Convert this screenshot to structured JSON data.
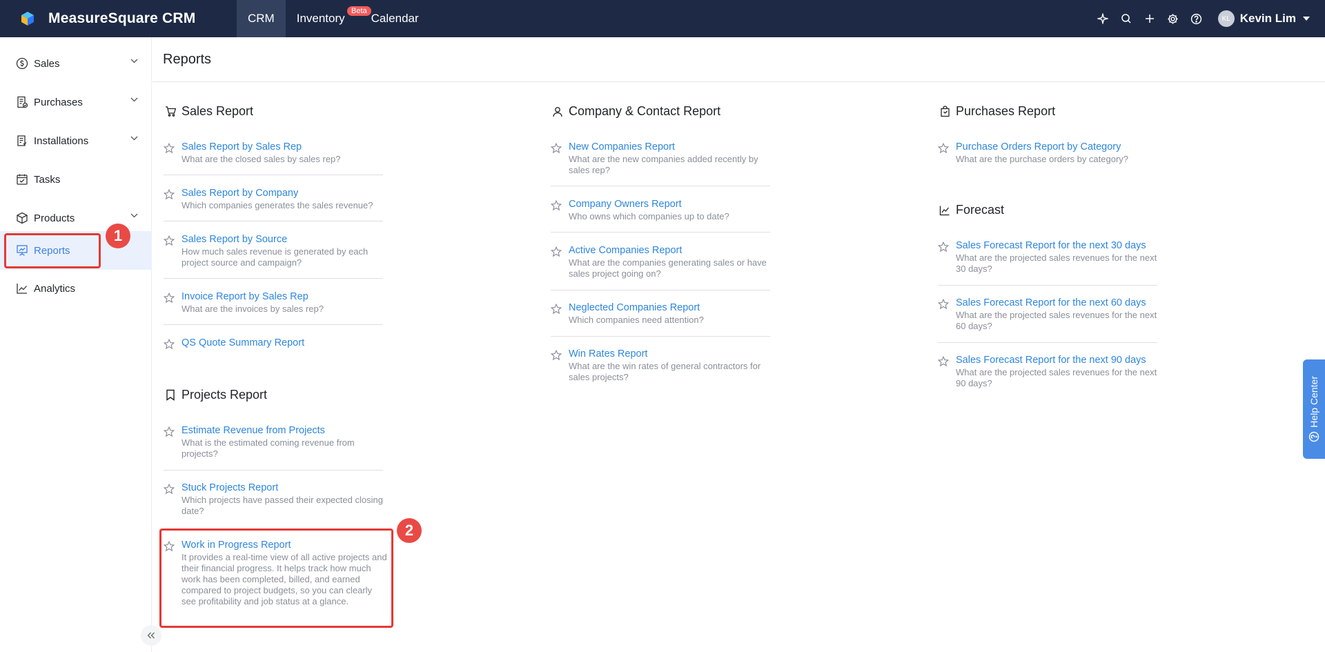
{
  "app": {
    "name": "MeasureSquare CRM",
    "nav": [
      {
        "label": "CRM",
        "active": true
      },
      {
        "label": "Inventory",
        "badge": "Beta"
      },
      {
        "label": "Calendar"
      }
    ],
    "user": {
      "initials": "KL",
      "name": "Kevin Lim"
    },
    "actions": [
      "sparkle-icon",
      "search-icon",
      "plus-icon",
      "gear-icon",
      "help-icon"
    ]
  },
  "sidebar": {
    "items": [
      {
        "label": "Sales",
        "icon": "dollar-icon",
        "expandable": true
      },
      {
        "label": "Purchases",
        "icon": "receipt-icon",
        "expandable": true
      },
      {
        "label": "Installations",
        "icon": "clipboard-icon",
        "expandable": true
      },
      {
        "label": "Tasks",
        "icon": "calendar-check-icon",
        "expandable": false
      },
      {
        "label": "Products",
        "icon": "box-icon",
        "expandable": true
      },
      {
        "label": "Reports",
        "icon": "chart-board-icon",
        "expandable": false,
        "active": true
      },
      {
        "label": "Analytics",
        "icon": "line-chart-icon",
        "expandable": false
      }
    ]
  },
  "annotations": {
    "one": "1",
    "two": "2"
  },
  "page": {
    "title": "Reports"
  },
  "sections": {
    "sales": {
      "title": "Sales Report",
      "reports": [
        {
          "name": "Sales Report by Sales Rep",
          "desc": "What are the closed sales by sales rep?"
        },
        {
          "name": "Sales Report by Company",
          "desc": "Which companies generates the sales revenue?"
        },
        {
          "name": "Sales Report by Source",
          "desc": "How much sales revenue is generated by each project source and campaign?"
        },
        {
          "name": "Invoice Report by Sales Rep",
          "desc": "What are the invoices by sales rep?"
        },
        {
          "name": "QS Quote Summary Report",
          "desc": ""
        }
      ]
    },
    "projects": {
      "title": "Projects Report",
      "reports": [
        {
          "name": "Estimate Revenue from Projects",
          "desc": "What is the estimated coming revenue from projects?"
        },
        {
          "name": "Stuck Projects Report",
          "desc": "Which projects have passed their expected closing date?"
        },
        {
          "name": "Work in Progress Report",
          "desc": "It provides a real-time view of all active projects and their financial progress. It helps track how much work has been completed, billed, and earned compared to project budgets, so you can clearly see profitability and job status at a glance."
        }
      ]
    },
    "company": {
      "title": "Company & Contact Report",
      "reports": [
        {
          "name": "New Companies Report",
          "desc": "What are the new companies added recently by sales rep?"
        },
        {
          "name": "Company Owners Report",
          "desc": "Who owns which companies up to date?"
        },
        {
          "name": "Active Companies Report",
          "desc": "What are the companies generating sales or have sales project going on?"
        },
        {
          "name": "Neglected Companies Report",
          "desc": "Which companies need attention?"
        },
        {
          "name": "Win Rates Report",
          "desc": "What are the win rates of general contractors for sales projects?"
        }
      ]
    },
    "purchases": {
      "title": "Purchases Report",
      "reports": [
        {
          "name": "Purchase Orders Report by Category",
          "desc": "What are the purchase orders by category?"
        }
      ]
    },
    "forecast": {
      "title": "Forecast",
      "reports": [
        {
          "name": "Sales Forecast Report for the next 30 days",
          "desc": "What are the projected sales revenues for the next 30 days?"
        },
        {
          "name": "Sales Forecast Report for the next 60 days",
          "desc": "What are the projected sales revenues for the next 60 days?"
        },
        {
          "name": "Sales Forecast Report for the next 90 days",
          "desc": "What are the projected sales revenues for the next 90 days?"
        }
      ]
    }
  },
  "help": {
    "label": "Help Center"
  },
  "colors": {
    "topbar": "#1e2a45",
    "link": "#2e86de",
    "highlight": "#e53935",
    "active_bg": "#eaf1fd"
  }
}
